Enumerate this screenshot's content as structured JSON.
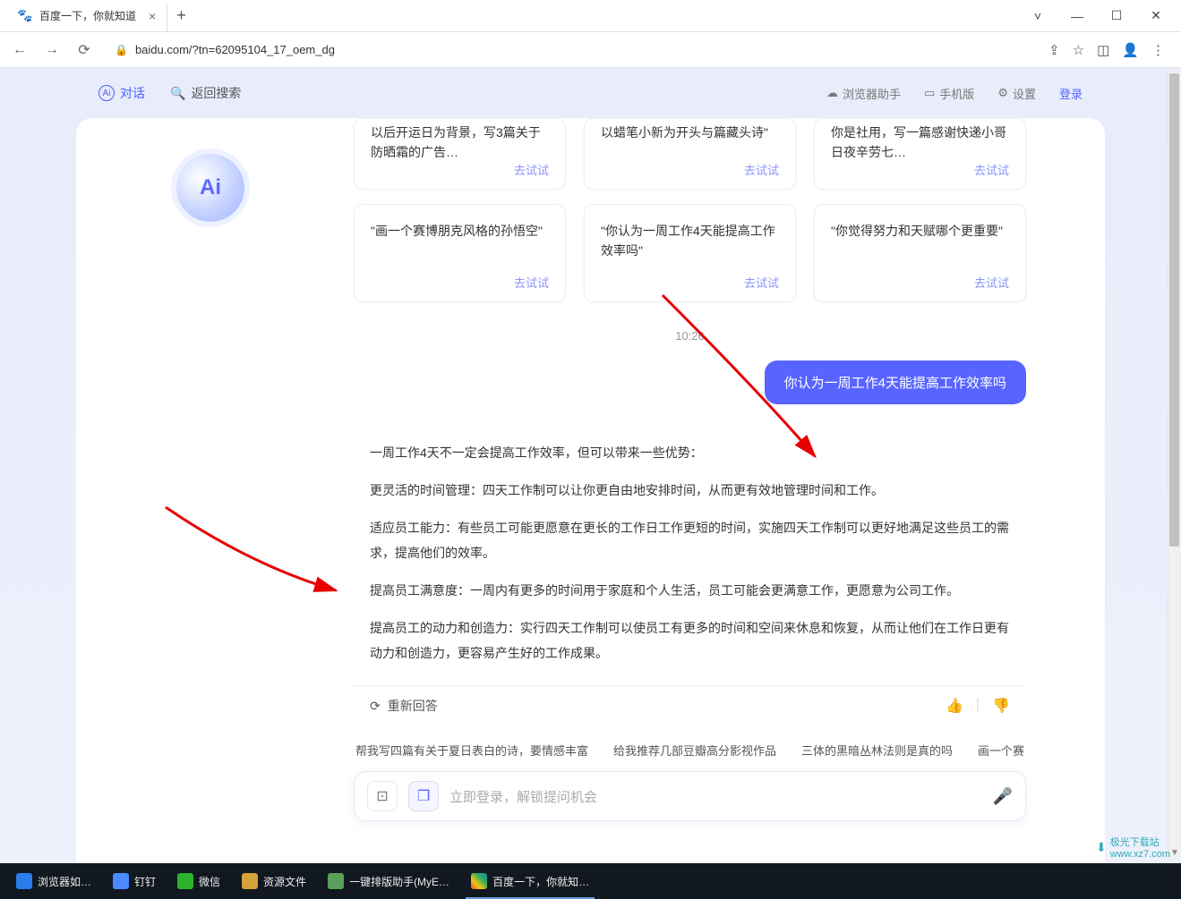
{
  "browser": {
    "tab_title": "百度一下，你就知道",
    "url": "baidu.com/?tn=62095104_17_oem_dg"
  },
  "header": {
    "dialog_tab": "对话",
    "return_search": "返回搜索",
    "browser_helper": "浏览器助手",
    "mobile": "手机版",
    "settings": "设置",
    "login": "登录"
  },
  "cards_row1": [
    {
      "text": "以后开运日为背景，写3篇关于防晒霜的广告…",
      "go": "去试试"
    },
    {
      "text": "以蜡笔小新为开头与篇藏头诗\"",
      "go": "去试试"
    },
    {
      "text": "你是社用，写一篇感谢快递小哥日夜辛劳七…",
      "go": "去试试"
    }
  ],
  "cards_row2": [
    {
      "text": "\"画一个赛博朋克风格的孙悟空\"",
      "go": "去试试"
    },
    {
      "text": "\"你认为一周工作4天能提高工作效率吗\"",
      "go": "去试试"
    },
    {
      "text": "\"你觉得努力和天赋哪个更重要\"",
      "go": "去试试"
    }
  ],
  "timestamp": "10:26",
  "user_msg": "你认为一周工作4天能提高工作效率吗",
  "ai_reply": [
    "一周工作4天不一定会提高工作效率，但可以带来一些优势：",
    "更灵活的时间管理：四天工作制可以让你更自由地安排时间，从而更有效地管理时间和工作。",
    "适应员工能力：有些员工可能更愿意在更长的工作日工作更短的时间，实施四天工作制可以更好地满足这些员工的需求，提高他们的效率。",
    "提高员工满意度：一周内有更多的时间用于家庭和个人生活，员工可能会更满意工作，更愿意为公司工作。",
    "提高员工的动力和创造力：实行四天工作制可以使员工有更多的时间和空间来休息和恢复，从而让他们在工作日更有动力和创造力，更容易产生好的工作成果。"
  ],
  "regen": "重新回答",
  "suggestions": [
    "帮我写四篇有关于夏日表白的诗，要情感丰富",
    "给我推荐几部豆瓣高分影视作品",
    "三体的黑暗丛林法则是真的吗",
    "画一个赛"
  ],
  "input_placeholder": "立即登录，解锁提问机会",
  "taskbar": {
    "items": [
      {
        "label": "浏览器如…"
      },
      {
        "label": "钉钉"
      },
      {
        "label": "微信"
      },
      {
        "label": "资源文件"
      },
      {
        "label": "一键排版助手(MyE…"
      },
      {
        "label": "百度一下，你就知…"
      }
    ]
  },
  "watermark": {
    "site": "极光下载站",
    "url": "www.xz7.com"
  }
}
